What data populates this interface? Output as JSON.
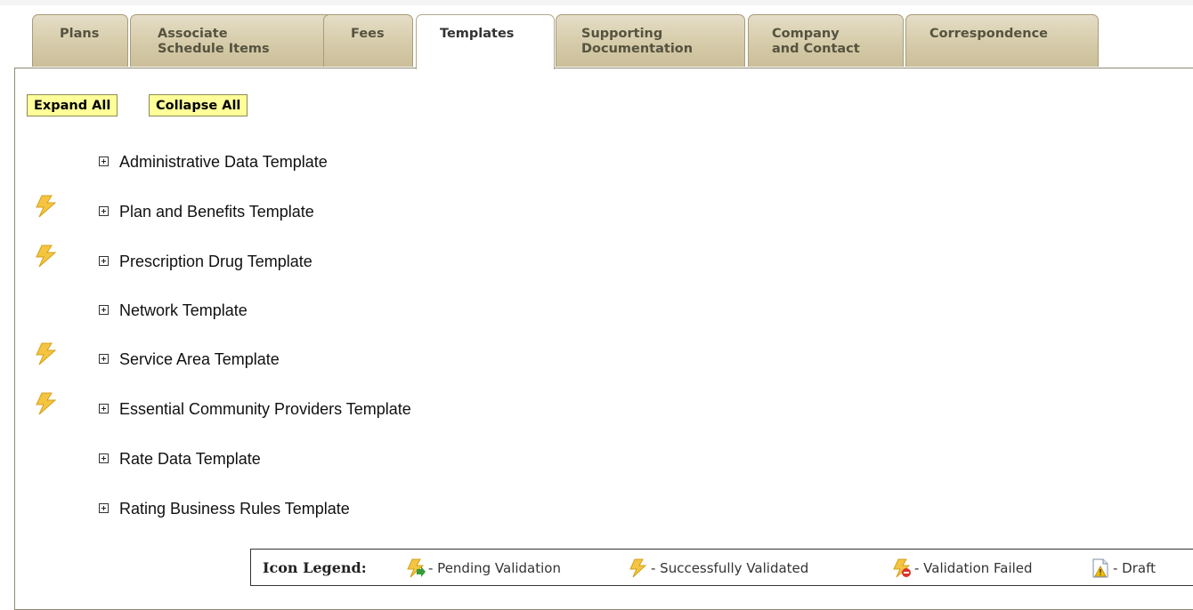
{
  "tabs": [
    {
      "label": "Plans",
      "active": false
    },
    {
      "label": "Associate\nSchedule Items",
      "active": false
    },
    {
      "label": "Fees",
      "active": false
    },
    {
      "label": "Templates",
      "active": true
    },
    {
      "label": "Supporting\nDocumentation",
      "active": false
    },
    {
      "label": "Company\nand Contact",
      "active": false
    },
    {
      "label": "Correspondence",
      "active": false
    }
  ],
  "toolbar": {
    "expand_all": "Expand All",
    "collapse_all": "Collapse All"
  },
  "templates": [
    {
      "label": "Administrative Data Template",
      "status_icon": null
    },
    {
      "label": "Plan and Benefits Template",
      "status_icon": "successfully-validated-icon"
    },
    {
      "label": "Prescription Drug Template",
      "status_icon": "successfully-validated-icon"
    },
    {
      "label": "Network Template",
      "status_icon": null
    },
    {
      "label": "Service Area Template",
      "status_icon": "successfully-validated-icon"
    },
    {
      "label": "Essential Community Providers Template",
      "status_icon": "successfully-validated-icon"
    },
    {
      "label": "Rate Data Template",
      "status_icon": null
    },
    {
      "label": "Rating Business Rules Template",
      "status_icon": null
    }
  ],
  "legend": {
    "title": "Icon Legend:",
    "pending": "- Pending Validation",
    "success": "- Successfully Validated",
    "failed": "- Validation Failed",
    "draft": "- Draft"
  },
  "colors": {
    "bolt": "#f5c542",
    "button_bg": "#ffff99",
    "tab_bg": "#d6cba9"
  }
}
